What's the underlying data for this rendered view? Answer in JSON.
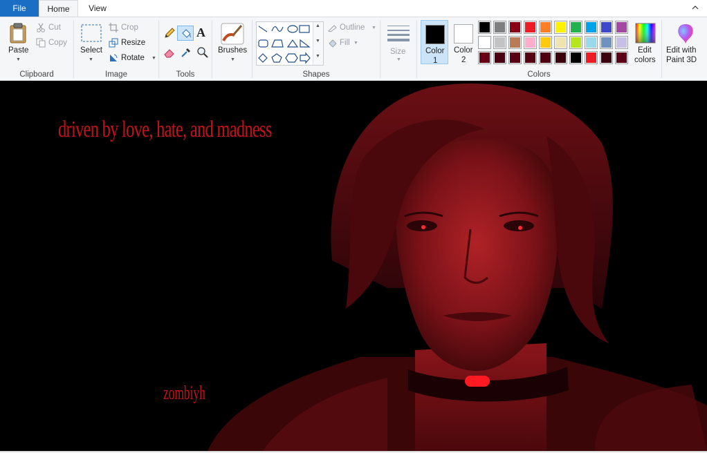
{
  "tabs": {
    "file": "File",
    "home": "Home",
    "view": "View"
  },
  "clipboard": {
    "paste": "Paste",
    "cut": "Cut",
    "copy": "Copy",
    "group": "Clipboard"
  },
  "image": {
    "select": "Select",
    "crop": "Crop",
    "resize": "Resize",
    "rotate": "Rotate",
    "group": "Image"
  },
  "tools": {
    "group": "Tools"
  },
  "brushes": {
    "label": "Brushes"
  },
  "shapes": {
    "outline": "Outline",
    "fill": "Fill",
    "group": "Shapes"
  },
  "size": {
    "label": "Size"
  },
  "colors": {
    "color1_label": "Color",
    "color1_num": "1",
    "color2_label": "Color",
    "color2_num": "2",
    "color1_value": "#000000",
    "color2_value": "#ffffff",
    "edit_colors_1": "Edit",
    "edit_colors_2": "colors",
    "group": "Colors",
    "palette": [
      [
        "#000000",
        "#7f7f7f",
        "#880015",
        "#ed1c24",
        "#ff7f27",
        "#fff200",
        "#22b14c",
        "#00a2e8",
        "#3f48cc",
        "#a349a4"
      ],
      [
        "#ffffff",
        "#c3c3c3",
        "#b97a57",
        "#ffaec9",
        "#ffc90e",
        "#efe4b0",
        "#b5e61d",
        "#99d9ea",
        "#7092be",
        "#c8bfe7"
      ],
      [
        "#650015",
        "#4a0010",
        "#5a0014",
        "#560010",
        "#4e0012",
        "#3a000c",
        "#000000",
        "#ed1c24",
        "#3d0010",
        "#5c0018"
      ]
    ]
  },
  "paint3d": {
    "line1": "Edit with",
    "line2": "Paint 3D"
  },
  "canvas_art": {
    "text_top": "driven by love, hate, and madness",
    "text_signature": "zombiyh"
  }
}
